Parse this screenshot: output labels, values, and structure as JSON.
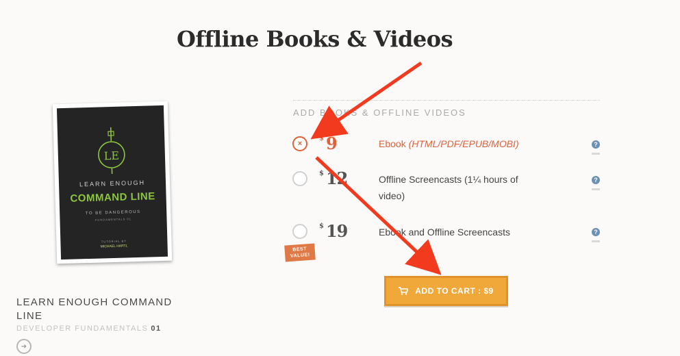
{
  "page": {
    "title": "Offline Books & Videos"
  },
  "cover": {
    "logo_text": "LE",
    "line1": "LEARN ENOUGH",
    "line2": "COMMAND LINE",
    "line3": "TO BE DANGEROUS",
    "line4": "FUNDAMENTALS 01",
    "line5": "TUTORIAL BY",
    "line6": "MICHAEL HARTL"
  },
  "product": {
    "title": "LEARN ENOUGH COMMAND LINE",
    "subtitle": "DEVELOPER FUNDAMENTALS",
    "number": "01"
  },
  "options_section": {
    "label": "ADD BOOKS & OFFLINE VIDEOS",
    "options": [
      {
        "currency": "$",
        "price": "9",
        "label": "Ebook ",
        "label_detail": "(HTML/PDF/EPUB/MOBI)",
        "selected": true,
        "radio_mark": "×",
        "help": "?"
      },
      {
        "currency": "$",
        "price": "12",
        "label": "Offline Screencasts (1¼ hours of video)",
        "selected": false,
        "help": "?"
      },
      {
        "currency": "$",
        "price": "19",
        "label": "Ebook and Offline Screencasts",
        "selected": false,
        "help": "?"
      }
    ],
    "badge": {
      "line1": "BEST",
      "line2": "VALUE!"
    }
  },
  "cart": {
    "label": "ADD TO CART : $9",
    "icon": "cart-icon"
  },
  "colors": {
    "accent": "#e0603a",
    "button": "#f0a83b",
    "arrow": "#f23a1f",
    "help": "#6d8fb0"
  }
}
